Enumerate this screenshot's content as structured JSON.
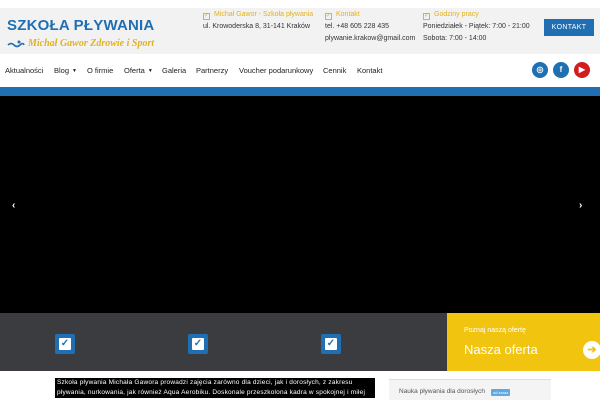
{
  "brand": {
    "title": "SZKOŁA PŁYWANIA",
    "subtitle": "Michał Gawor Zdrowie i Sport",
    "title_color": "#1f6fb2",
    "subtitle_color": "#e3b21c"
  },
  "header": {
    "address": {
      "heading": "Michał Gawor - Szkoła pływania",
      "line1": "ul. Krowoderska 8, 31-141 Kraków"
    },
    "contact": {
      "heading": "Kontakt",
      "phone": "tel. +48 605 228 435",
      "email": "plywanie.krakow@gmail.com"
    },
    "hours": {
      "heading": "Godziny pracy",
      "weekdays": "Poniedziałek - Piątek: 7:00 - 21:00",
      "saturday": "Sobota: 7:00 - 14:00"
    },
    "button": "KONTAKT"
  },
  "nav": {
    "items": [
      {
        "label": "Aktualności"
      },
      {
        "label": "Blog"
      },
      {
        "label": "O firmie"
      },
      {
        "label": "Oferta"
      },
      {
        "label": "Galeria"
      },
      {
        "label": "Partnerzy"
      },
      {
        "label": "Voucher podarunkowy"
      },
      {
        "label": "Cennik"
      },
      {
        "label": "Kontakt"
      }
    ],
    "caret": "▼"
  },
  "social": {
    "instagram_icon": "instagram-icon",
    "facebook_icon": "facebook-icon",
    "youtube_icon": "youtube-icon",
    "instagram_glyph": "◎",
    "facebook_glyph": "f",
    "youtube_glyph": "▶"
  },
  "slider": {
    "prev": "‹",
    "next": "›",
    "background": "#000000"
  },
  "features": {
    "check_glyph": "✓"
  },
  "offer": {
    "small": "Poznaj naszą ofertę",
    "big": "Nasza oferta",
    "arrow": "➔",
    "color": "#f1c40f"
  },
  "about": {
    "text": "Szkoła pływania Michała Gawora prowadzi zajęcia zarówno dla dzieci, jak i dorosłych, z zakresu pływania, nurkowania, jak również Aqua Aerobiku. Doskonale przeszkolona kadra w spokojnej i miłej",
    "card_title": "Nauka pływania dla dorosłych",
    "card_badge": "od zaraz"
  }
}
